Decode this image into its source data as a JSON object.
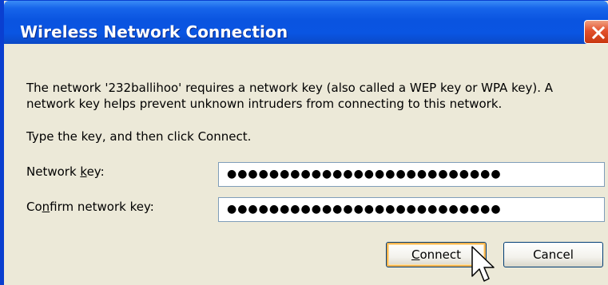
{
  "window": {
    "title": "Wireless Network Connection"
  },
  "dialog": {
    "description_line1": "The network '232ballihoo' requires a network key (also called a WEP key or WPA key). A",
    "description_line2": "network key helps prevent unknown intruders from connecting to this network.",
    "instruction": "Type the key, and then click Connect.",
    "network_key": {
      "label_pre": "Network ",
      "label_accel": "k",
      "label_post": "ey:",
      "value": "●●●●●●●●●●●●●●●●●●●●●●●●●●"
    },
    "confirm_key": {
      "label_pre": "Co",
      "label_accel": "n",
      "label_post": "firm network key:",
      "value": "●●●●●●●●●●●●●●●●●●●●●●●●●●"
    },
    "buttons": {
      "connect_accel": "C",
      "connect_rest": "onnect",
      "cancel": "Cancel"
    }
  },
  "icons": {
    "close": "close-icon",
    "cursor": "mouse-pointer-icon"
  },
  "colors": {
    "titlebar": "#0a54e0",
    "close_button": "#e2502c",
    "dialog_background": "#ece9d8",
    "default_button_highlight": "#f8b44e"
  }
}
